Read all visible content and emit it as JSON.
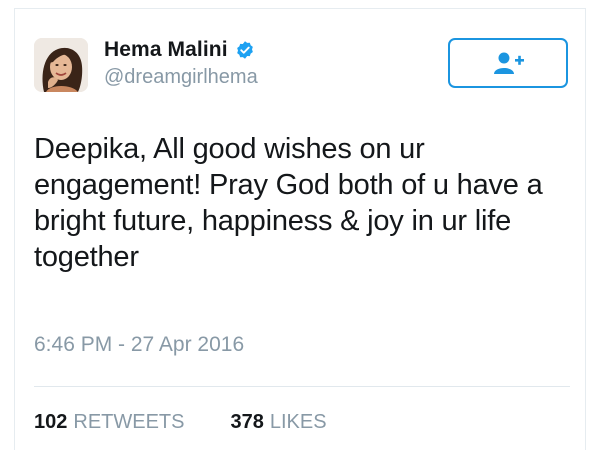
{
  "tweet": {
    "author": {
      "display_name": "Hema Malini",
      "handle": "@dreamgirlhema",
      "verified": true,
      "avatar_icon": "profile-photo-icon"
    },
    "follow_button": {
      "icon": "add-user-icon"
    },
    "text": "Deepika, All good wishes on ur engagement! Pray God both of u have a bright future, happiness & joy in ur life together",
    "timestamp": "6:46 PM - 27 Apr 2016",
    "stats": {
      "retweets_count": "102",
      "retweets_label": "RETWEETS",
      "likes_count": "378",
      "likes_label": "LIKES"
    }
  },
  "colors": {
    "accent": "#1b95e0",
    "text": "#14171a",
    "secondary": "#8899a6",
    "divider": "#e1e8ed"
  }
}
